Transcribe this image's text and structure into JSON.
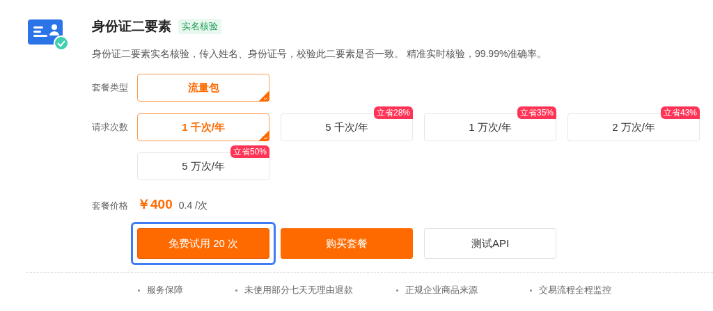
{
  "product": {
    "title": "身份证二要素",
    "tag": "实名核验",
    "description": "身份证二要素实名核验，传入姓名、身份证号，校验此二要素是否一致。 精准实时核验，99.99%准确率。"
  },
  "option_groups": [
    {
      "label": "套餐类型",
      "options": [
        {
          "label": "流量包",
          "selected": true
        }
      ]
    },
    {
      "label": "请求次数",
      "options": [
        {
          "label": "1 千次/年",
          "selected": true
        },
        {
          "label": "5 千次/年",
          "selected": false,
          "badge": "立省28%"
        },
        {
          "label": "1 万次/年",
          "selected": false,
          "badge": "立省35%"
        },
        {
          "label": "2 万次/年",
          "selected": false,
          "badge": "立省43%"
        },
        {
          "label": "5 万次/年",
          "selected": false,
          "badge": "立省50%"
        }
      ]
    }
  ],
  "price": {
    "label": "套餐价格",
    "amount": "￥400",
    "unit": "0.4 /次"
  },
  "buttons": [
    {
      "label": "免费试用 20 次",
      "kind": "primary",
      "focused": true
    },
    {
      "label": "购买套餐",
      "kind": "primary",
      "focused": false
    },
    {
      "label": "测试API",
      "kind": "secondary",
      "focused": false
    }
  ],
  "guarantees": [
    "服务保障",
    "未使用部分七天无理由退款",
    "正规企业商品来源",
    "交易流程全程监控"
  ]
}
